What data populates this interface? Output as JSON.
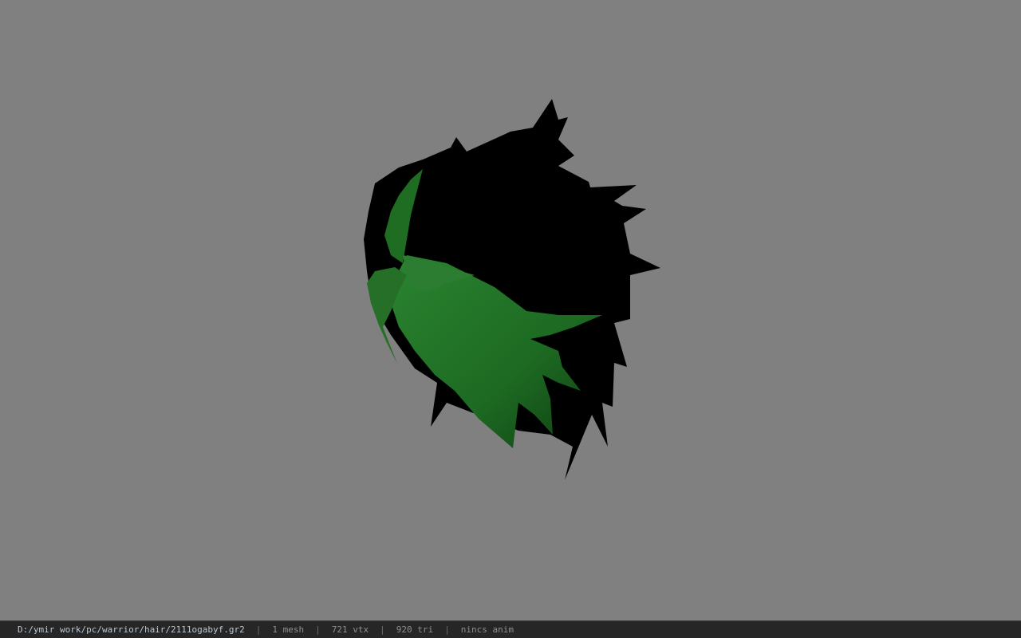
{
  "viewport": {
    "background": "#808080",
    "model": "hair-mesh",
    "colors": {
      "hair_dark": "#000000",
      "hair_green": "#1f6b24",
      "hair_green_light": "#2f8a33"
    }
  },
  "status_bar": {
    "file_path": "D:/ymir work/pc/warrior/hair/2111ogabyf.gr2",
    "separator": "|",
    "mesh_count": "1 mesh",
    "vertex_count": "721 vtx",
    "triangle_count": "920 tri",
    "anim_status": "nincs anim"
  }
}
